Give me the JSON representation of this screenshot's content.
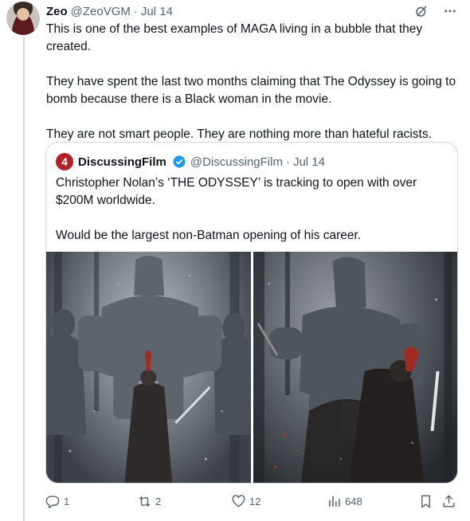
{
  "tweet": {
    "author_name": "Zeo",
    "author_handle": "@ZeoVGM",
    "separator": "·",
    "date": "Jul 14",
    "paragraphs": [
      "This is one of the best examples of MAGA living in a bubble that they created.",
      "They have spent the last two months claiming that The Odyssey is going to bomb because there is a Black woman in the movie.",
      "They are not smart people. They are nothing more than hateful racists."
    ]
  },
  "quote": {
    "avatar_glyph": "4",
    "author_name": "DiscussingFilm",
    "author_handle": "@DiscussingFilm",
    "separator": "·",
    "date": "Jul 14",
    "paragraphs": [
      "Christopher Nolan’s ‘THE ODYSSEY’ is tracking to open with over $200M worldwide.",
      "Would be the largest non-Batman opening of his career."
    ]
  },
  "actions": {
    "replies": "1",
    "reposts": "2",
    "likes": "12",
    "views": "648"
  },
  "icons": {
    "top": [
      "grok-icon",
      "more-icon"
    ],
    "bottom": [
      "reply-icon",
      "repost-icon",
      "like-icon",
      "views-icon",
      "bookmark-icon",
      "share-icon"
    ]
  },
  "colors": {
    "text": "#0f1419",
    "muted": "#536471",
    "border": "#cfd9de",
    "verified": "#1d9bf0",
    "quote_avatar": "#b32028"
  }
}
